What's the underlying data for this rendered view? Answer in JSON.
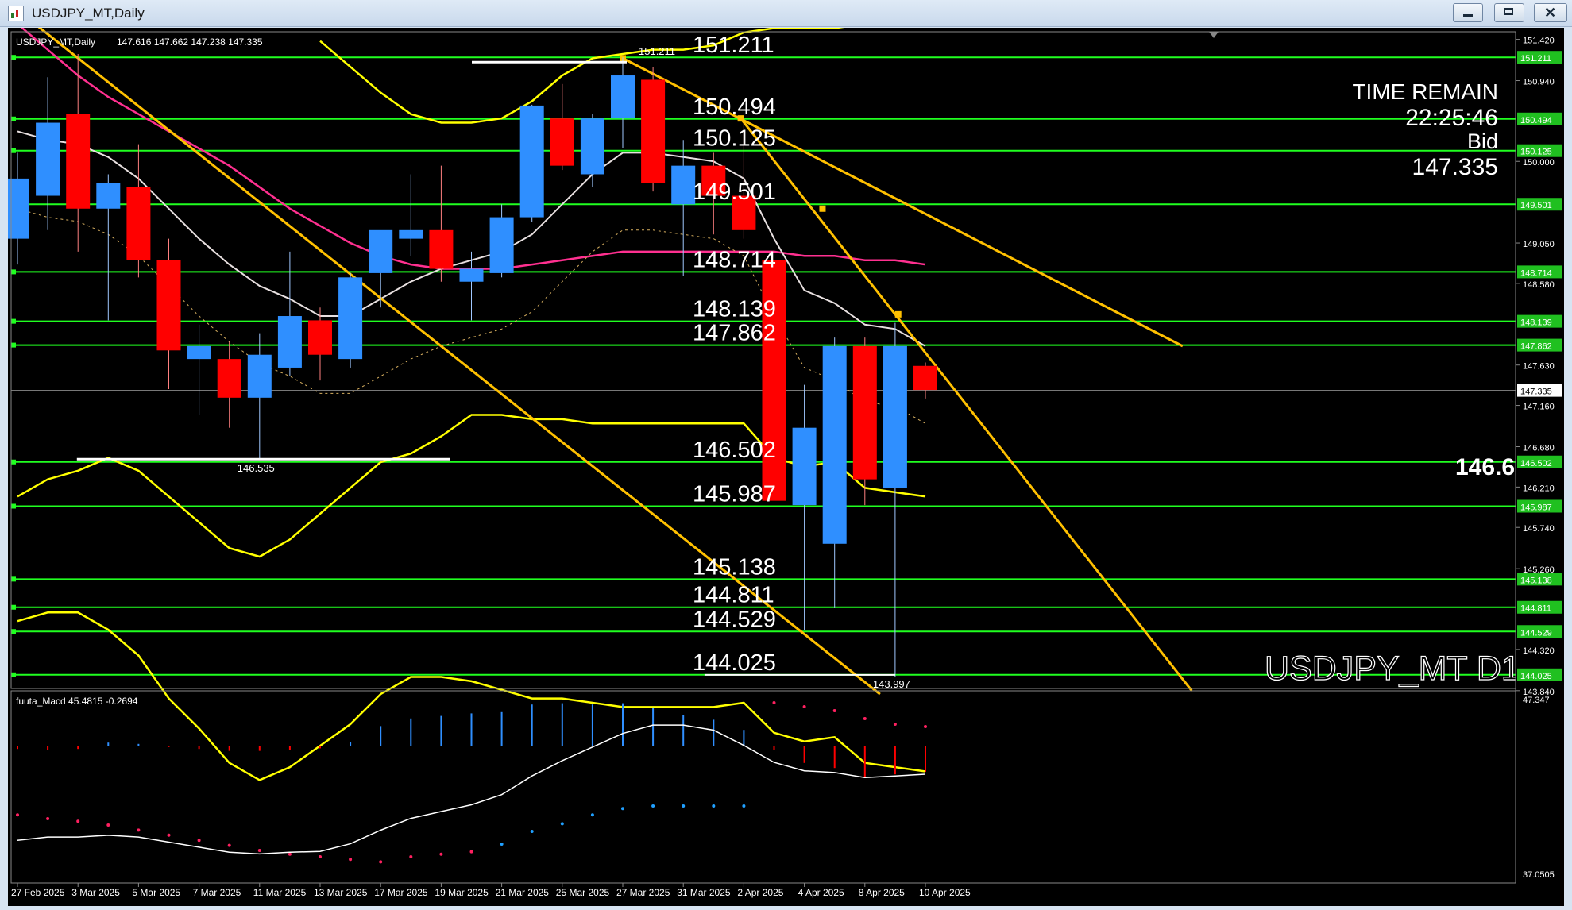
{
  "window": {
    "title": "USDJPY_MT,Daily"
  },
  "colors": {
    "background": "#000000",
    "bull": "#2f8fff",
    "bear": "#ff0000",
    "level_line": "#20ff20",
    "trendline": "#ffc000",
    "bands": "#ffff00",
    "ma_fast": "#e8e0e0",
    "ma_slow": "#ff3090",
    "text": "#ffffff",
    "axis_text": "#ffffff"
  },
  "chart_data": [
    {
      "type": "candlestick",
      "title": "USDJPY_MT,Daily",
      "ohlc_header": "147.616 147.662 147.238 147.335",
      "ylim": [
        143.84,
        151.42
      ],
      "y_ticks": [
        "151.420",
        "150.940",
        "150.000",
        "149.050",
        "148.580",
        "147.630",
        "147.160",
        "146.680",
        "146.210",
        "145.740",
        "145.260",
        "144.320",
        "143.840"
      ],
      "x_ticks": [
        {
          "i": 0,
          "label": "27 Feb 2025"
        },
        {
          "i": 2,
          "label": "3 Mar 2025"
        },
        {
          "i": 4,
          "label": "5 Mar 2025"
        },
        {
          "i": 6,
          "label": "7 Mar 2025"
        },
        {
          "i": 8,
          "label": "11 Mar 2025"
        },
        {
          "i": 10,
          "label": "13 Mar 2025"
        },
        {
          "i": 12,
          "label": "17 Mar 2025"
        },
        {
          "i": 14,
          "label": "19 Mar 2025"
        },
        {
          "i": 16,
          "label": "21 Mar 2025"
        },
        {
          "i": 18,
          "label": "25 Mar 2025"
        },
        {
          "i": 20,
          "label": "27 Mar 2025"
        },
        {
          "i": 22,
          "label": "31 Mar 2025"
        },
        {
          "i": 24,
          "label": "2 Apr 2025"
        },
        {
          "i": 26,
          "label": "4 Apr 2025"
        },
        {
          "i": 28,
          "label": "8 Apr 2025"
        },
        {
          "i": 30,
          "label": "10 Apr 2025"
        }
      ],
      "candles": [
        {
          "o": 149.1,
          "h": 150.1,
          "l": 148.8,
          "c": 149.8
        },
        {
          "o": 149.6,
          "h": 150.98,
          "l": 149.2,
          "c": 150.45
        },
        {
          "o": 150.55,
          "h": 151.25,
          "l": 148.95,
          "c": 149.45
        },
        {
          "o": 149.45,
          "h": 149.85,
          "l": 148.15,
          "c": 149.75
        },
        {
          "o": 149.7,
          "h": 150.2,
          "l": 148.65,
          "c": 148.85
        },
        {
          "o": 148.85,
          "h": 149.1,
          "l": 147.35,
          "c": 147.8
        },
        {
          "o": 147.7,
          "h": 148.1,
          "l": 147.05,
          "c": 147.85
        },
        {
          "o": 147.7,
          "h": 147.9,
          "l": 146.9,
          "c": 147.25
        },
        {
          "o": 147.25,
          "h": 148.0,
          "l": 146.54,
          "c": 147.75
        },
        {
          "o": 147.6,
          "h": 148.95,
          "l": 147.5,
          "c": 148.2
        },
        {
          "o": 148.15,
          "h": 148.3,
          "l": 147.45,
          "c": 147.75
        },
        {
          "o": 147.7,
          "h": 148.7,
          "l": 147.6,
          "c": 148.65
        },
        {
          "o": 148.7,
          "h": 149.15,
          "l": 148.3,
          "c": 149.2
        },
        {
          "o": 149.1,
          "h": 149.85,
          "l": 148.9,
          "c": 149.2
        },
        {
          "o": 149.2,
          "h": 149.95,
          "l": 148.6,
          "c": 148.75
        },
        {
          "o": 148.6,
          "h": 148.95,
          "l": 148.15,
          "c": 148.75
        },
        {
          "o": 148.7,
          "h": 149.5,
          "l": 148.65,
          "c": 149.35
        },
        {
          "o": 149.35,
          "h": 150.66,
          "l": 149.3,
          "c": 150.65
        },
        {
          "o": 150.5,
          "h": 150.9,
          "l": 149.9,
          "c": 149.95
        },
        {
          "o": 149.85,
          "h": 150.55,
          "l": 149.7,
          "c": 150.5
        },
        {
          "o": 150.5,
          "h": 151.21,
          "l": 150.15,
          "c": 151.0
        },
        {
          "o": 150.95,
          "h": 151.1,
          "l": 149.65,
          "c": 149.75
        },
        {
          "o": 149.5,
          "h": 150.25,
          "l": 148.67,
          "c": 149.95
        },
        {
          "o": 149.95,
          "h": 150.1,
          "l": 149.15,
          "c": 149.6
        },
        {
          "o": 149.6,
          "h": 150.5,
          "l": 149.1,
          "c": 149.2
        },
        {
          "o": 148.85,
          "h": 148.9,
          "l": 145.2,
          "c": 146.05
        },
        {
          "o": 146.0,
          "h": 147.4,
          "l": 144.55,
          "c": 146.9
        },
        {
          "o": 145.55,
          "h": 147.95,
          "l": 144.8,
          "c": 147.85
        },
        {
          "o": 147.85,
          "h": 147.95,
          "l": 146.0,
          "c": 146.3
        },
        {
          "o": 146.2,
          "h": 148.12,
          "l": 143.997,
          "c": 147.85
        },
        {
          "o": 147.62,
          "h": 147.66,
          "l": 147.24,
          "c": 147.34
        }
      ],
      "level_lines": [
        151.211,
        150.494,
        150.125,
        149.501,
        148.714,
        148.139,
        147.862,
        146.502,
        145.987,
        145.138,
        144.811,
        144.529,
        144.025
      ],
      "level_labels": [
        "151.211",
        "150.494",
        "150.125",
        "149.501",
        "148.714",
        "148.139",
        "147.862",
        "146.502",
        "145.987",
        "145.138",
        "144.811",
        "144.529",
        "144.025"
      ],
      "current_price": "147.335",
      "high_marker": {
        "i": 20,
        "value": "151.211"
      },
      "low_marker": {
        "i": 29,
        "value": "143.997"
      },
      "low_marker_2": {
        "i": 8,
        "value": "146.535"
      },
      "partial_right_label": "146.6",
      "ma_fast": [
        150.35,
        150.25,
        150.2,
        150.05,
        149.8,
        149.45,
        149.1,
        148.8,
        148.55,
        148.4,
        148.2,
        148.2,
        148.4,
        148.6,
        148.75,
        148.85,
        148.95,
        149.15,
        149.5,
        149.85,
        150.1,
        150.1,
        150.05,
        150.0,
        149.8,
        149.1,
        148.5,
        148.35,
        148.1,
        148.05,
        147.85
      ],
      "ma_slow": [
        151.6,
        151.3,
        151.0,
        150.75,
        150.55,
        150.35,
        150.15,
        149.95,
        149.7,
        149.45,
        149.25,
        149.05,
        148.9,
        148.8,
        148.75,
        148.75,
        148.75,
        148.8,
        148.85,
        148.9,
        148.95,
        148.95,
        148.95,
        148.95,
        148.95,
        148.95,
        148.9,
        148.9,
        148.85,
        148.85,
        148.8
      ],
      "band_upper": [
        null,
        null,
        null,
        null,
        null,
        null,
        null,
        null,
        null,
        null,
        151.4,
        151.1,
        150.8,
        150.55,
        150.45,
        150.45,
        150.5,
        150.7,
        151.0,
        151.2,
        151.25,
        151.3,
        151.3,
        151.35,
        151.5,
        151.55,
        151.55,
        151.55,
        151.6,
        151.6,
        151.6
      ],
      "band_mid": [
        146.1,
        146.3,
        146.4,
        146.55,
        146.4,
        146.1,
        145.8,
        145.5,
        145.4,
        145.6,
        145.9,
        146.2,
        146.5,
        146.6,
        146.8,
        147.05,
        147.05,
        147.0,
        147.0,
        146.95,
        146.95,
        146.95,
        146.95,
        146.95,
        146.95,
        146.55,
        146.45,
        146.5,
        146.2,
        146.15,
        146.1
      ],
      "band_lower": [
        147.85,
        147.95,
        147.95,
        147.75,
        147.45,
        146.95,
        146.6,
        146.2,
        146.0,
        146.15,
        146.4,
        146.65,
        147.0,
        147.2,
        147.2,
        147.15,
        147.05,
        146.95,
        146.95,
        146.9,
        146.85,
        146.85,
        146.85,
        146.85,
        146.9,
        146.55,
        146.45,
        146.5,
        146.2,
        146.15,
        146.1
      ],
      "trendlines": [
        {
          "x1": -0.5,
          "y1": 151.9,
          "x2": 28.5,
          "y2": 143.8
        },
        {
          "x1": 20.0,
          "y1": 151.2,
          "x2": 38.5,
          "y2": 147.85
        },
        {
          "x1": 23.9,
          "y1": 150.5,
          "x2": 38.8,
          "y2": 143.84
        }
      ],
      "trend_points": [
        {
          "x": 20.0,
          "y": 151.2
        },
        {
          "x": 23.9,
          "y": 150.5
        },
        {
          "x": 26.6,
          "y": 149.45
        },
        {
          "x": 29.1,
          "y": 148.22
        }
      ]
    },
    {
      "type": "macd",
      "title": "fuuta_Macd 45.4815 -0.2694",
      "ylim": [
        37.0505,
        47.347
      ],
      "y_ticks": [
        "47.347",
        "37.0505"
      ],
      "histogram": [
        -0.2,
        -0.25,
        -0.2,
        0.3,
        0.2,
        -0.05,
        -0.2,
        -0.35,
        -0.35,
        -0.3,
        -0.15,
        0.35,
        1.6,
        2.2,
        2.4,
        2.6,
        2.7,
        3.3,
        3.4,
        3.3,
        3.4,
        3.0,
        2.5,
        2.1,
        1.3,
        -0.3,
        -1.3,
        -1.7,
        -2.5,
        -2.2,
        -2.0
      ],
      "signal_dots": [
        -0.35,
        -0.5,
        -0.6,
        -0.75,
        -0.95,
        -1.15,
        -1.35,
        -1.55,
        -1.75,
        -1.9,
        -2.0,
        -2.1,
        -2.2,
        -2.0,
        -1.9,
        -1.8,
        -1.5,
        -1.0,
        -0.7,
        -0.35,
        -0.1,
        0.0,
        0.0,
        0.0,
        0.0,
        0.05,
        0.15,
        0.25,
        0.3,
        0.3,
        0.35
      ],
      "line": [
        39.0,
        39.2,
        39.2,
        39.3,
        39.2,
        38.9,
        38.6,
        38.3,
        38.2,
        38.3,
        38.35,
        38.8,
        39.6,
        40.3,
        40.7,
        41.1,
        41.7,
        42.8,
        43.7,
        44.5,
        45.3,
        45.8,
        45.8,
        45.5,
        44.6,
        43.6,
        43.1,
        43.0,
        42.7,
        42.8,
        42.9
      ]
    }
  ],
  "overlay": {
    "time_remain_label": "TIME REMAIN",
    "time_remain_value": "22:25:46",
    "bid_label": "Bid",
    "bid_value": "147.335",
    "symbol_watermark": "USDJPY_MT D1"
  }
}
